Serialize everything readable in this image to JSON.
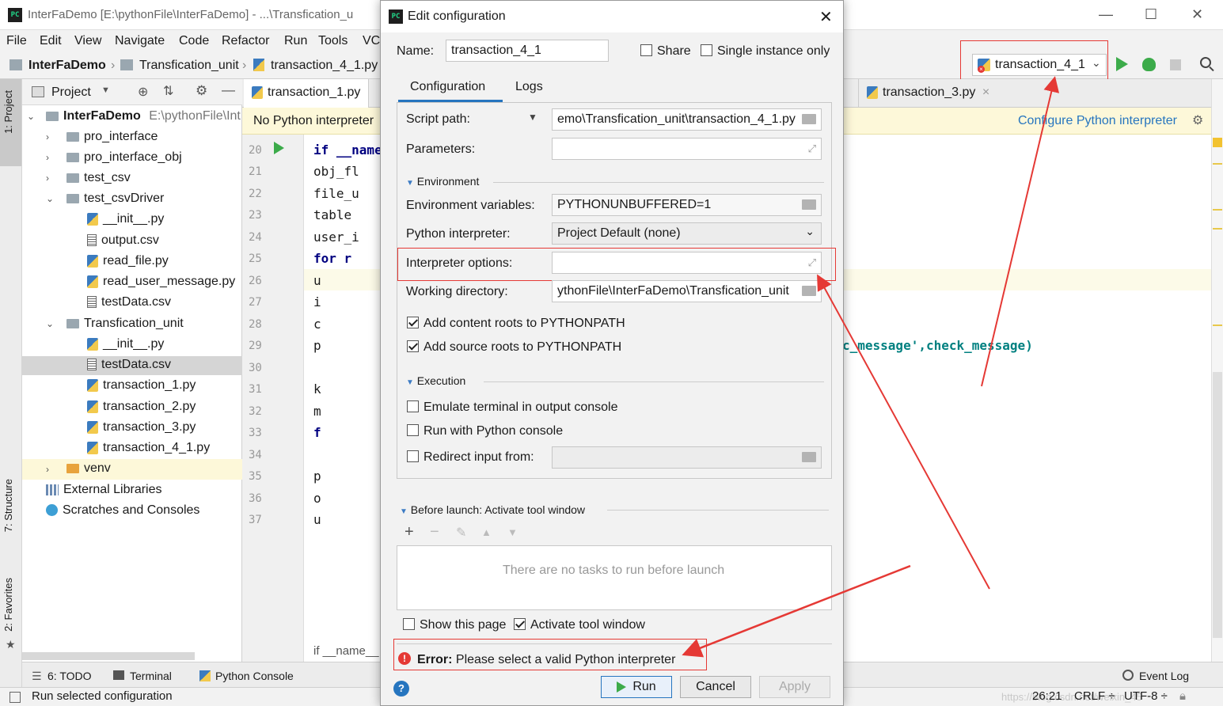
{
  "window": {
    "title": "InterFaDemo [E:\\pythonFile\\InterFaDemo] - ...\\Transfication_u",
    "app_logo": "PC"
  },
  "menu": [
    "File",
    "Edit",
    "View",
    "Navigate",
    "Code",
    "Refactor",
    "Run",
    "Tools",
    "VC"
  ],
  "breadcrumb": [
    "InterFaDemo",
    "Transfication_unit",
    "transaction_4_1.py"
  ],
  "run_config": {
    "selected": "transaction_4_1"
  },
  "left_strip": {
    "project": "1: Project",
    "structure": "7: Structure",
    "favorites": "2: Favorites"
  },
  "project_pane": {
    "header": "Project",
    "root": {
      "name": "InterFaDemo",
      "path": "E:\\pythonFile\\Int"
    },
    "items": [
      {
        "name": "pro_interface",
        "type": "folder",
        "level": 1,
        "expanded": false
      },
      {
        "name": "pro_interface_obj",
        "type": "folder",
        "level": 1,
        "expanded": false
      },
      {
        "name": "test_csv",
        "type": "folder",
        "level": 1,
        "expanded": false
      },
      {
        "name": "test_csvDriver",
        "type": "folder",
        "level": 1,
        "expanded": true
      },
      {
        "name": "__init__.py",
        "type": "py",
        "level": 2
      },
      {
        "name": "output.csv",
        "type": "csv",
        "level": 2
      },
      {
        "name": "read_file.py",
        "type": "py",
        "level": 2
      },
      {
        "name": "read_user_message.py",
        "type": "py",
        "level": 2
      },
      {
        "name": "testData.csv",
        "type": "csv",
        "level": 2
      },
      {
        "name": "Transfication_unit",
        "type": "folder",
        "level": 1,
        "expanded": true
      },
      {
        "name": "__init__.py",
        "type": "py",
        "level": 2
      },
      {
        "name": "testData.csv",
        "type": "csv",
        "level": 2,
        "selected": true
      },
      {
        "name": "transaction_1.py",
        "type": "py",
        "level": 2
      },
      {
        "name": "transaction_2.py",
        "type": "py",
        "level": 2
      },
      {
        "name": "transaction_3.py",
        "type": "py",
        "level": 2
      },
      {
        "name": "transaction_4_1.py",
        "type": "py",
        "level": 2
      },
      {
        "name": "venv",
        "type": "folder-orange",
        "level": 1,
        "expanded": false
      }
    ],
    "external_libraries": "External Libraries",
    "scratches": "Scratches and Consoles"
  },
  "editor": {
    "tabs": [
      "transaction_1.py",
      "transaction_3.py"
    ],
    "banner": "No Python interpreter",
    "banner_link": "Configure Python interpreter",
    "line_numbers": [
      "20",
      "21",
      "22",
      "23",
      "24",
      "25",
      "26",
      "27",
      "28",
      "29",
      "30",
      "31",
      "32",
      "33",
      "34",
      "35",
      "36",
      "37"
    ],
    "code_lines": [
      "if __name",
      "    obj_fl",
      "    file_u",
      "    table",
      "    user_i",
      "    for r",
      "        u",
      "        i",
      "        c",
      "        p",
      "",
      "        k",
      "        m",
      "        f",
      "",
      "        p",
      "        o",
      "        u"
    ],
    "code_right": "c_message',check_message)",
    "breadcrumb_bottom": "if __name__"
  },
  "bottom_tools": [
    "6: TODO",
    "Terminal",
    "Python Console",
    "Event Log"
  ],
  "status": {
    "left": "Run selected configuration",
    "position": "26:21",
    "line_sep": "CRLF ÷",
    "encoding": "UTF-8 ÷",
    "watermark": "https://blog.csdn.net/weixin_45"
  },
  "dialog": {
    "title": "Edit configuration",
    "name_label": "Name:",
    "name_value": "transaction_4_1",
    "share_label": "Share",
    "single_instance_label": "Single instance only",
    "tabs": [
      "Configuration",
      "Logs"
    ],
    "script_path_label": "Script path:",
    "script_path_value": "emo\\Transfication_unit\\transaction_4_1.py",
    "parameters_label": "Parameters:",
    "parameters_value": "",
    "environment_section": "Environment",
    "env_vars_label": "Environment variables:",
    "env_vars_value": "PYTHONUNBUFFERED=1",
    "interpreter_label": "Python interpreter:",
    "interpreter_value": "Project Default (none)",
    "interp_options_label": "Interpreter options:",
    "interp_options_value": "",
    "workdir_label": "Working directory:",
    "workdir_value": "ythonFile\\InterFaDemo\\Transfication_unit",
    "add_content_roots": "Add content roots to PYTHONPATH",
    "add_source_roots": "Add source roots to PYTHONPATH",
    "execution_section": "Execution",
    "emulate_terminal": "Emulate terminal in output console",
    "run_with_console": "Run with Python console",
    "redirect_input": "Redirect input from:",
    "before_launch": "Before launch: Activate tool window",
    "no_tasks": "There are no tasks to run before launch",
    "show_page": "Show this page",
    "activate_window": "Activate tool window",
    "error_prefix": "Error:",
    "error_text": "Please select a valid Python interpreter",
    "run_btn": "Run",
    "cancel_btn": "Cancel",
    "apply_btn": "Apply",
    "help": "?"
  },
  "colors": {
    "accent": "#2675bf",
    "error": "#e53935",
    "run_green": "#3cab4a",
    "banner_bg": "#fdf8d9"
  }
}
